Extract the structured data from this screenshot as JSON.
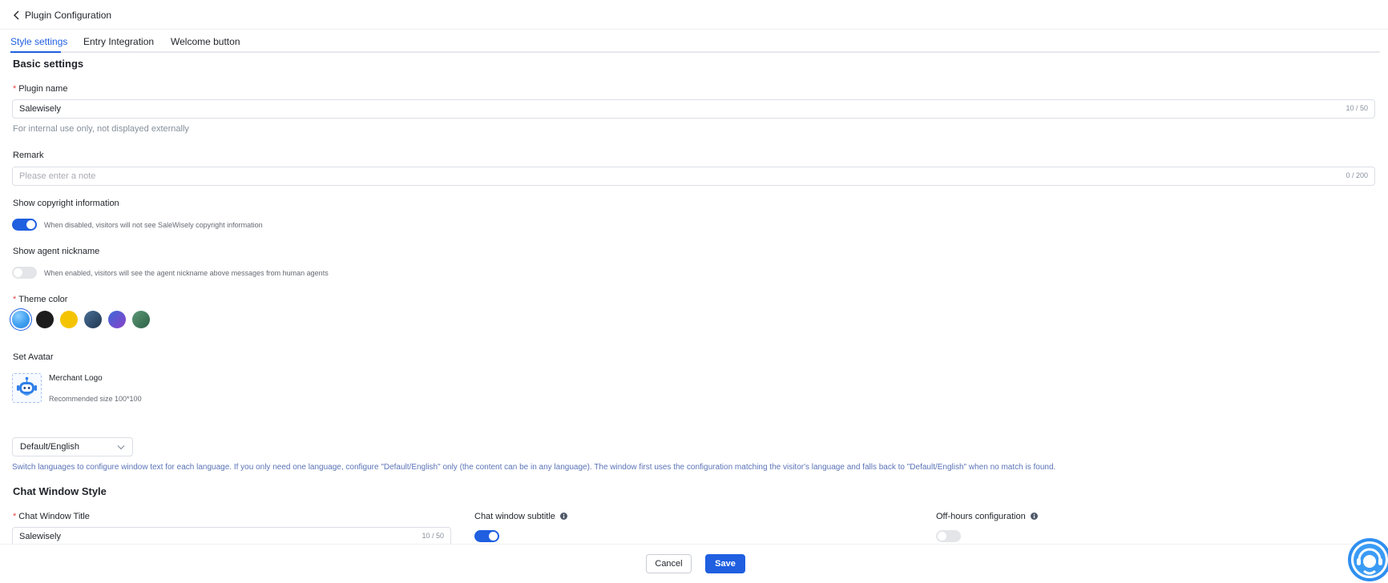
{
  "header": {
    "back_label": "Plugin Configuration"
  },
  "tabs": [
    {
      "label": "Style settings",
      "active": true
    },
    {
      "label": "Entry Integration",
      "active": false
    },
    {
      "label": "Welcome button",
      "active": false
    }
  ],
  "basic": {
    "title": "Basic settings",
    "plugin_name": {
      "label": "Plugin name",
      "value": "Salewisely",
      "counter": "10 / 50",
      "hint": "For internal use only, not displayed externally"
    },
    "remark": {
      "label": "Remark",
      "placeholder": "Please enter a note",
      "counter": "0 / 200"
    },
    "copyright": {
      "label": "Show copyright information",
      "enabled": true,
      "hint": "When disabled, visitors will not see SaleWisely copyright information"
    },
    "nickname": {
      "label": "Show agent nickname",
      "enabled": false,
      "hint": "When enabled, visitors will see the agent nickname above messages from human agents"
    },
    "theme": {
      "label": "Theme color",
      "swatches": [
        {
          "name": "blue",
          "color": "#3f9ef0",
          "selected": true
        },
        {
          "name": "black",
          "color": "#1c1c1c",
          "selected": false
        },
        {
          "name": "yellow",
          "color": "#f5c400",
          "selected": false
        },
        {
          "name": "navy-gradient",
          "color": "#2e4d6e",
          "selected": false
        },
        {
          "name": "purple-gradient",
          "color": "#6b4fd0",
          "selected": false
        },
        {
          "name": "green-gradient",
          "color": "#3c7a5a",
          "selected": false
        }
      ]
    },
    "avatar": {
      "label": "Set Avatar",
      "name": "Merchant Logo",
      "hint": "Recommended size 100*100"
    }
  },
  "language": {
    "selected": "Default/English",
    "hint": "Switch languages to configure window text for each language. If you only need one language, configure \"Default/English\" only (the content can be in any language). The window first uses the configuration matching the visitor's language and falls back to \"Default/English\" when no match is found."
  },
  "chat_window": {
    "title": "Chat Window Style",
    "window_title": {
      "label": "Chat Window Title",
      "value": "Salewisely",
      "counter": "10 / 50"
    },
    "subtitle": {
      "label": "Chat window subtitle",
      "enabled": true
    },
    "off_hours": {
      "label": "Off-hours configuration",
      "enabled": false
    }
  },
  "footer": {
    "cancel_label": "Cancel",
    "save_label": "Save"
  },
  "colors": {
    "accent": "#1f5fe0",
    "required": "#e5484d",
    "hint_blue": "#5b74b8"
  },
  "icons": [
    "chevron-left-icon",
    "chevron-down-icon",
    "info-icon",
    "robot-avatar-icon",
    "support-agent-icon"
  ]
}
